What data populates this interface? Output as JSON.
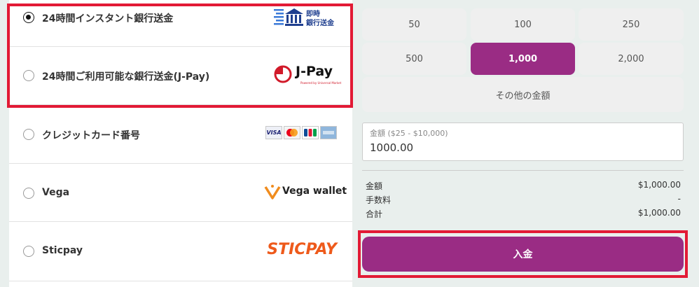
{
  "payment_methods": [
    {
      "label": "24時間インスタント銀行送金",
      "checked": true,
      "logo": "instant-bank-logo",
      "logo_text_line1": "即時",
      "logo_text_line2": "銀行送金"
    },
    {
      "label": "24時間ご利用可能な銀行送金(J-Pay)",
      "checked": false,
      "logo": "jpay-logo",
      "logo_text": "J-Pay",
      "logo_subtext": "Powered by Universal Market"
    },
    {
      "label": "クレジットカード番号",
      "checked": false,
      "logo": "card-brands-logo",
      "card_brands": [
        "VISA",
        "Mastercard",
        "JCB",
        "AMEX"
      ]
    },
    {
      "label": "Vega",
      "checked": false,
      "logo": "vega-wallet-logo",
      "logo_text": "Vega wallet"
    },
    {
      "label": "Sticpay",
      "checked": false,
      "logo": "sticpay-logo",
      "logo_text": "STICPAY"
    }
  ],
  "amount_options": [
    "50",
    "100",
    "250",
    "500",
    "1,000",
    "2,000"
  ],
  "selected_amount": "1,000",
  "other_amount_label": "その他の金額",
  "amount_field": {
    "label": "金額 ($25 - $10,000)",
    "value": "1000.00"
  },
  "summary": [
    {
      "label": "金額",
      "value": "$1,000.00"
    },
    {
      "label": "手数料",
      "value": "-"
    },
    {
      "label": "合計",
      "value": "$1,000.00"
    }
  ],
  "deposit_button_label": "入金",
  "colors": {
    "accent": "#9a2c84",
    "highlight": "#e21a35",
    "background": "#e9efed"
  }
}
